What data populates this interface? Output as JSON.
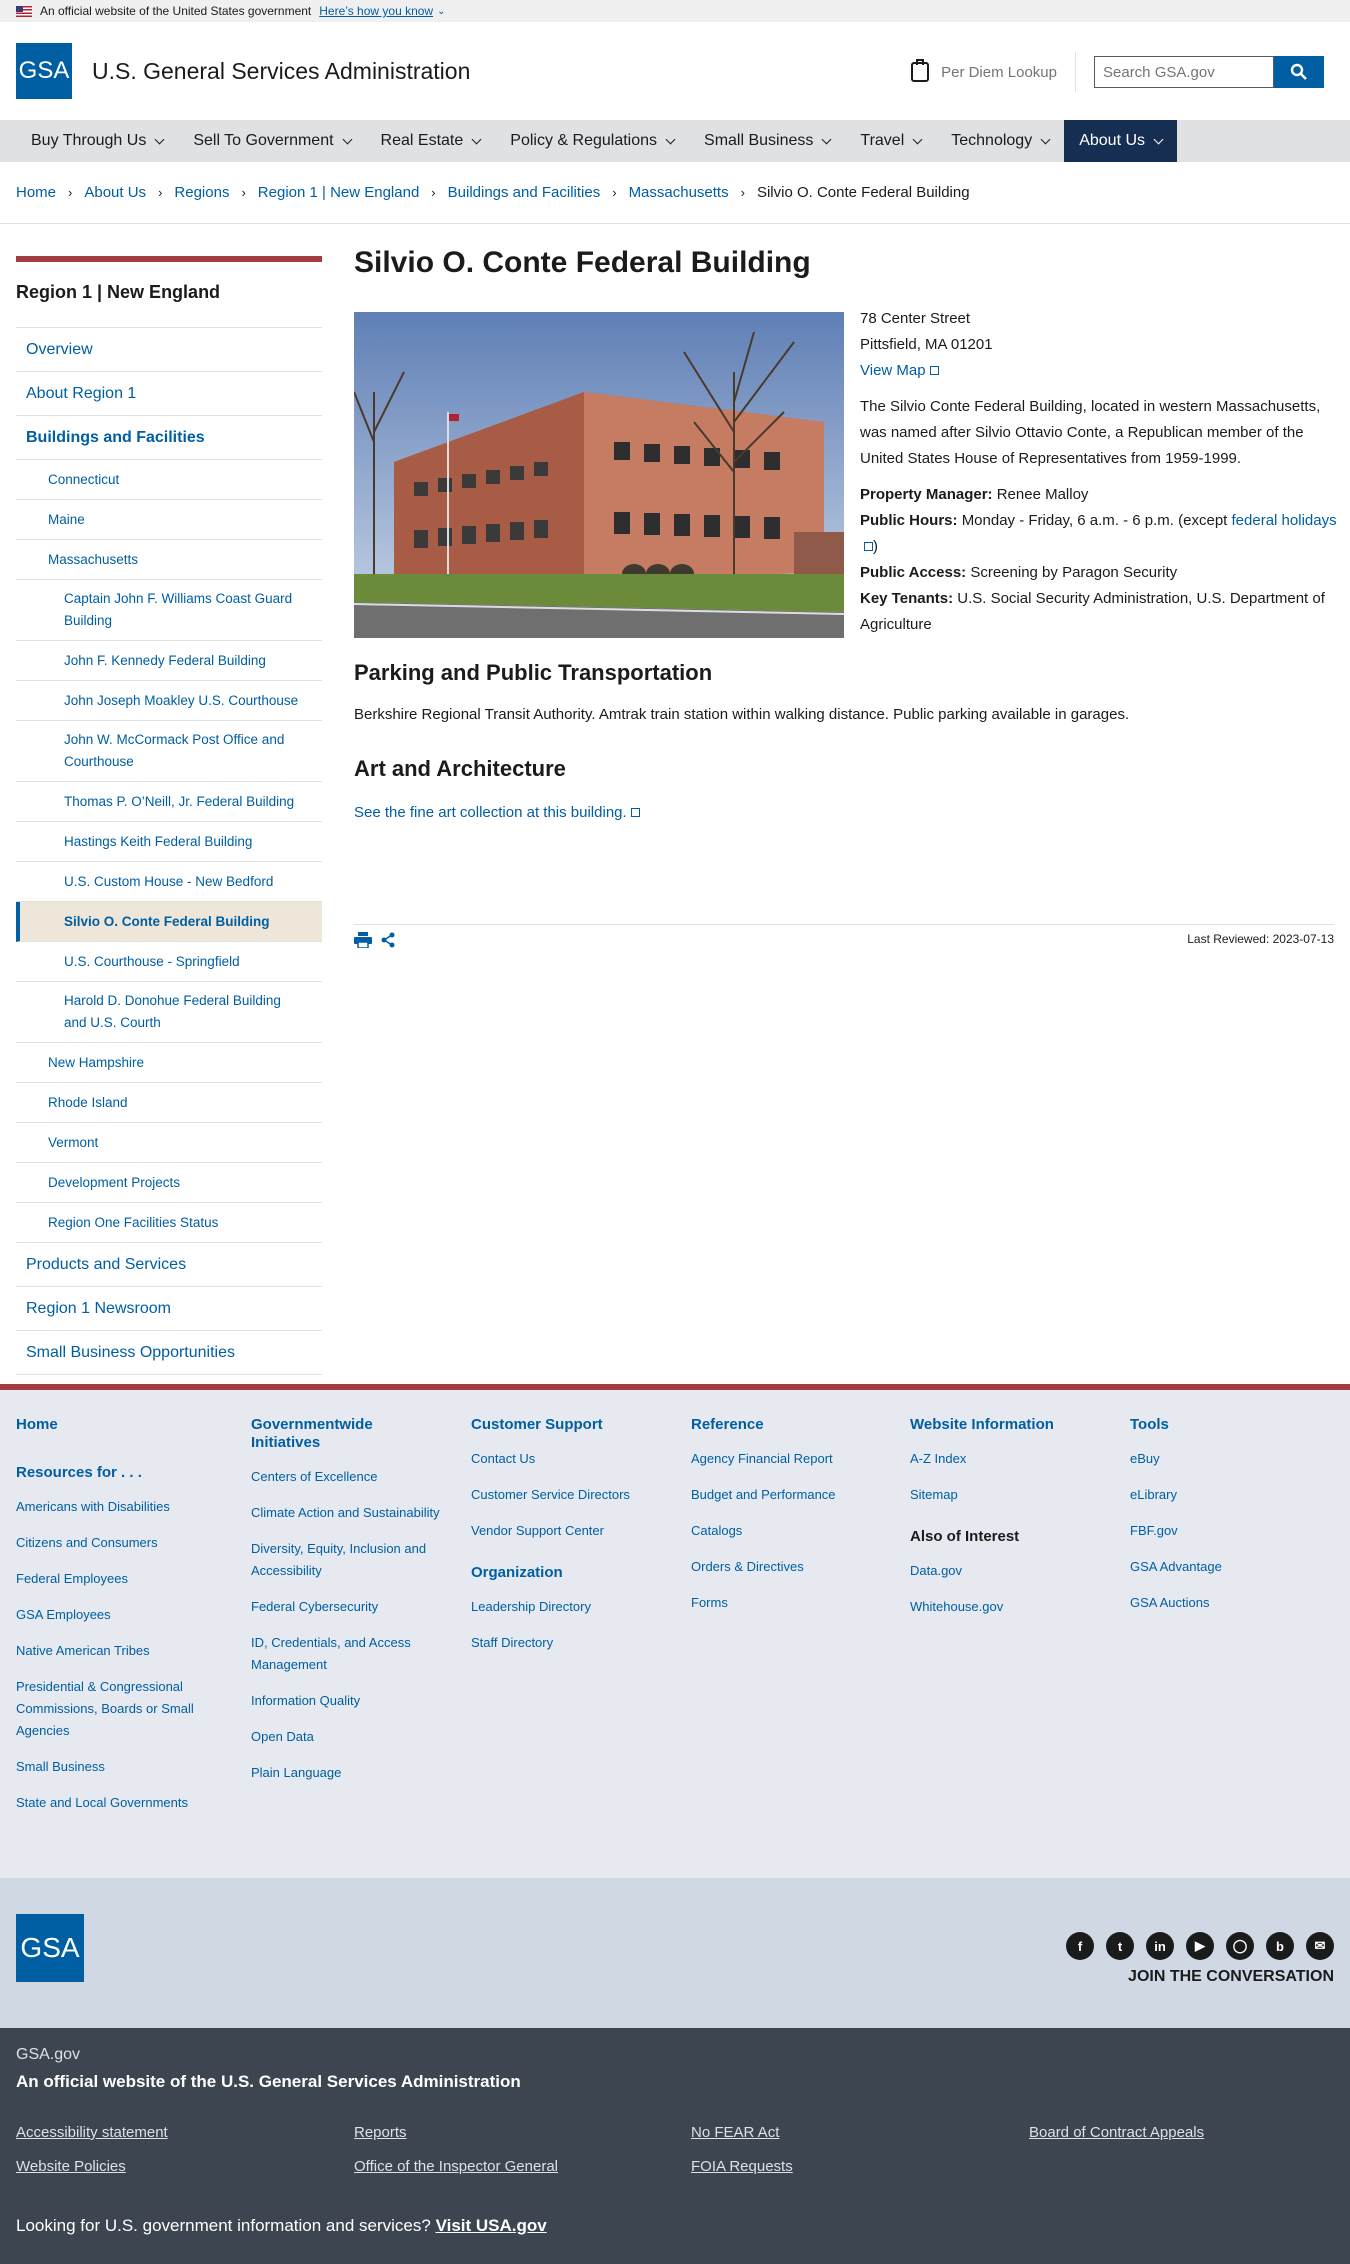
{
  "banner": {
    "text": "An official website of the United States government",
    "link": "Here’s how you know"
  },
  "header": {
    "logo": "GSA",
    "agency": "U.S. General Services Administration",
    "per_diem": "Per Diem Lookup",
    "search_placeholder": "Search GSA.gov"
  },
  "nav": [
    "Buy Through Us",
    "Sell To Government",
    "Real Estate",
    "Policy & Regulations",
    "Small Business",
    "Travel",
    "Technology",
    "About Us"
  ],
  "breadcrumb": [
    "Home",
    "About Us",
    "Regions",
    "Region 1 | New England",
    "Buildings and Facilities",
    "Massachusetts"
  ],
  "breadcrumb_current": "Silvio O. Conte Federal Building",
  "sidebar": {
    "title": "Region 1 | New England",
    "top": [
      "Overview",
      "About Region 1"
    ],
    "open": "Buildings and Facilities",
    "states_before": [
      "Connecticut",
      "Maine"
    ],
    "open_state": "Massachusetts",
    "buildings": [
      "Captain John F. Williams Coast Guard Building",
      "John F. Kennedy Federal Building",
      "John Joseph Moakley U.S. Courthouse",
      "John W. McCormack Post Office and Courthouse",
      "Thomas P. O’Neill, Jr. Federal Building",
      "Hastings Keith Federal Building",
      "U.S. Custom House - New Bedford",
      "Silvio O. Conte Federal Building",
      "U.S. Courthouse - Springfield",
      "Harold D. Donohue Federal Building and U.S. Courth"
    ],
    "states_after": [
      "New Hampshire",
      "Rhode Island",
      "Vermont",
      "Development Projects",
      "Region One Facilities Status"
    ],
    "bottom": [
      "Products and Services",
      "Region 1 Newsroom",
      "Small Business Opportunities"
    ]
  },
  "page": {
    "title": "Silvio O. Conte Federal Building",
    "address1": "78 Center Street",
    "address2": "Pittsfield, MA 01201",
    "view_map": "View Map",
    "description": "The Silvio Conte Federal Building, located in western Massachusetts, was named after Silvio Ottavio Conte, a Republican member of the United States House of Representatives from 1959-1999.",
    "manager_label": "Property Manager:",
    "manager": "Renee Malloy",
    "hours_label": "Public Hours:",
    "hours": "Monday - Friday, 6 a.m. - 6 p.m. (except",
    "holidays": "federal holidays",
    "hours_end": ")",
    "access_label": "Public Access:",
    "access": "Screening by Paragon Security",
    "tenants_label": "Key Tenants:",
    "tenants": "U.S. Social Security Administration, U.S. Department of Agriculture",
    "parking_heading": "Parking and Public Transportation",
    "parking_text": "Berkshire Regional Transit Authority. Amtrak train station within walking distance. Public parking available in garages.",
    "art_heading": "Art and Architecture",
    "art_link": "See the fine art collection at this building.",
    "last_reviewed": "Last Reviewed: 2023-07-13"
  },
  "footer": {
    "home": "Home",
    "resources_heading": "Resources for . . .",
    "resources": [
      "Americans with Disabilities",
      "Citizens and Consumers",
      "Federal Employees",
      "GSA Employees",
      "Native American Tribes",
      "Presidential & Congressional Commissions, Boards or Small Agencies",
      "Small Business",
      "State and Local Governments"
    ],
    "initiatives_heading": "Governmentwide Initiatives",
    "initiatives": [
      "Centers of Excellence",
      "Climate Action and Sustainability",
      "Diversity, Equity, Inclusion and Accessibility",
      "Federal Cybersecurity",
      "ID, Credentials, and Access Management",
      "Information Quality",
      "Open Data",
      "Plain Language"
    ],
    "support_heading": "Customer Support",
    "support": [
      "Contact Us",
      "Customer Service Directors",
      "Vendor Support Center"
    ],
    "org_heading": "Organization",
    "org": [
      "Leadership Directory",
      "Staff Directory"
    ],
    "reference_heading": "Reference",
    "reference": [
      "Agency Financial Report",
      "Budget and Performance",
      "Catalogs",
      "Orders & Directives",
      "Forms"
    ],
    "website_heading": "Website Information",
    "website": [
      "A-Z Index",
      "Sitemap"
    ],
    "interest_heading": "Also of Interest",
    "interest": [
      "Data.gov",
      "Whitehouse.gov"
    ],
    "tools_heading": "Tools",
    "tools": [
      "eBuy",
      "eLibrary",
      "FBF.gov",
      "GSA Advantage",
      "GSA Auctions"
    ],
    "join": "JOIN THE CONVERSATION",
    "site": "GSA.gov",
    "official": "An official website of the U.S. General Services Administration",
    "bottom_links": [
      "Accessibility statement",
      "Reports",
      "No FEAR Act",
      "Board of Contract Appeals",
      "Website Policies",
      "Office of the Inspector General",
      "FOIA Requests"
    ],
    "usa_text": "Looking for U.S. government information and services?",
    "usa_link": "Visit USA.gov"
  },
  "colors": {
    "primary": "#005ea2",
    "nav_active": "#162e51",
    "accent_red": "#a23c41",
    "footer_bg": "#e6eaf0",
    "footer_dark": "#3d4551"
  }
}
